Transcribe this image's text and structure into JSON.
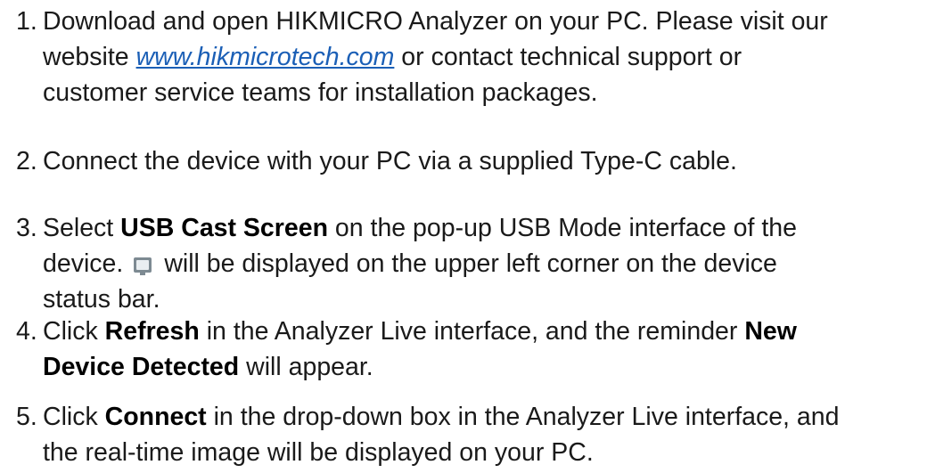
{
  "steps": [
    {
      "num": "1.",
      "line1": "Download and open HIKMICRO Analyzer on your PC. Please visit our",
      "line2_pre": "website ",
      "link": "www.hikmicrotech.com",
      "line2_post": " or contact technical support or",
      "line3": "customer service teams for installation packages."
    },
    {
      "num": "2.",
      "text": "Connect the device with your PC via a supplied Type-C cable."
    },
    {
      "num": "3.",
      "pre": "Select ",
      "bold": "USB Cast Screen",
      "line1_post": " on the pop-up USB Mode interface of the",
      "line2_pre": "device.",
      "icon": "screen-cast-icon",
      "line2_post": "will be displayed on the upper left corner on the device",
      "line3": "status bar."
    },
    {
      "num": "4.",
      "pre": "Click ",
      "bold1": "Refresh",
      "mid": " in the Analyzer Live interface, and the reminder ",
      "bold2a": "New",
      "bold2b": "Device Detected",
      "post": " will appear."
    },
    {
      "num": "5.",
      "pre": "Click ",
      "bold": "Connect",
      "line1_post": " in the drop-down box in the Analyzer Live interface, and",
      "line2": "the real-time image will be displayed on your PC."
    }
  ]
}
